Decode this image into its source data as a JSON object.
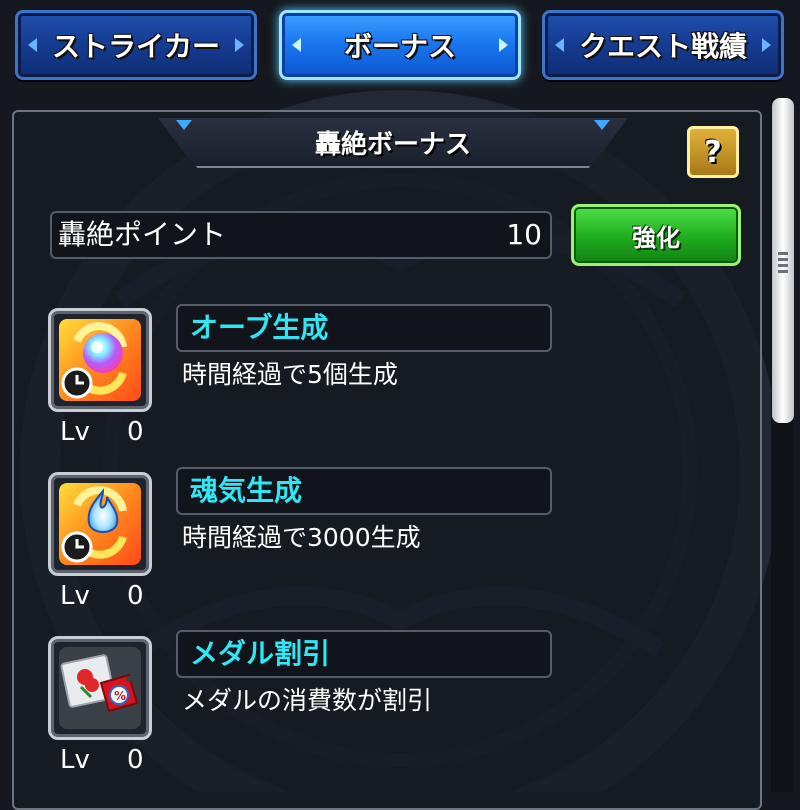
{
  "tabs": [
    {
      "label": "ストライカー",
      "active": false
    },
    {
      "label": "ボーナス",
      "active": true
    },
    {
      "label": "クエスト戦績",
      "active": false
    }
  ],
  "panel": {
    "title": "轟絶ボーナス",
    "help_label": "?"
  },
  "points": {
    "label": "轟絶ポイント",
    "value": "10",
    "button_label": "強化"
  },
  "bonuses": [
    {
      "name": "オーブ生成",
      "description": "時間経過で5個生成",
      "lv_label": "Lv",
      "lv_value": "0",
      "icon": "orb-generation-icon"
    },
    {
      "name": "魂気生成",
      "description": "時間経過で3000生成",
      "lv_label": "Lv",
      "lv_value": "0",
      "icon": "soul-generation-icon"
    },
    {
      "name": "メダル割引",
      "description": "メダルの消費数が割引",
      "lv_label": "Lv",
      "lv_value": "0",
      "icon": "medal-discount-icon"
    }
  ],
  "colors": {
    "accent_cyan": "#2fe6f2",
    "tab_blue": "#1a78f0",
    "button_green": "#22b021",
    "help_gold": "#c9962a"
  }
}
